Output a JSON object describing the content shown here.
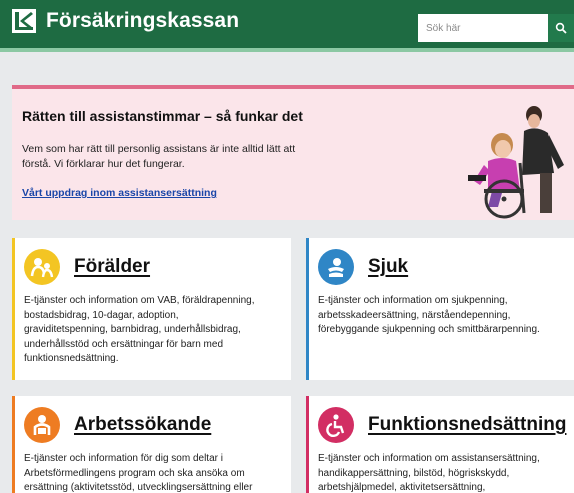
{
  "header": {
    "brand": "Försäkringskassan",
    "search_placeholder": "Sök här"
  },
  "hero": {
    "title": "Rätten till assistanstimmar – så funkar det",
    "text": "Vem som har rätt till personlig assistans är inte alltid lätt att förstå. Vi förklarar hur det fungerar.",
    "link": "Vårt uppdrag inom assistansersättning"
  },
  "cards": [
    {
      "title": "Förälder",
      "icon": "parent-child-icon",
      "color": "#f3c523",
      "lines": [
        "E-tjänster och information om VAB, föräldrapenning,",
        "bostadsbidrag, 10-dagar, adoption,",
        "graviditetspenning, barnbidrag, underhållsbidrag,",
        "underhållsstöd och ersättningar för barn med",
        "funktionsnedsättning."
      ]
    },
    {
      "title": "Sjuk",
      "icon": "sick-person-icon",
      "color": "#2f86c6",
      "lines": [
        "E-tjänster och information om sjukpenning,",
        "arbetsskadeersättning, närståendepenning,",
        "förebyggande sjukpenning och smittbärarpenning."
      ]
    },
    {
      "title": "Arbetssökande",
      "icon": "job-seeker-icon",
      "color": "#ee7c22",
      "lines": [
        "E-tjänster och information för dig som deltar i",
        "Arbetsförmedlingens program och ska ansöka om",
        "ersättning (aktivitetsstöd, utvecklingsersättning eller"
      ]
    },
    {
      "title": "Funktionsnedsättning",
      "icon": "wheelchair-icon",
      "color": "#d22e63",
      "lines": [
        "E-tjänster och information om assistansersättning,",
        "handikappersättning, bilstöd, högriskskydd,",
        "arbetshjälpmedel, aktivitetsersättning,"
      ]
    }
  ]
}
